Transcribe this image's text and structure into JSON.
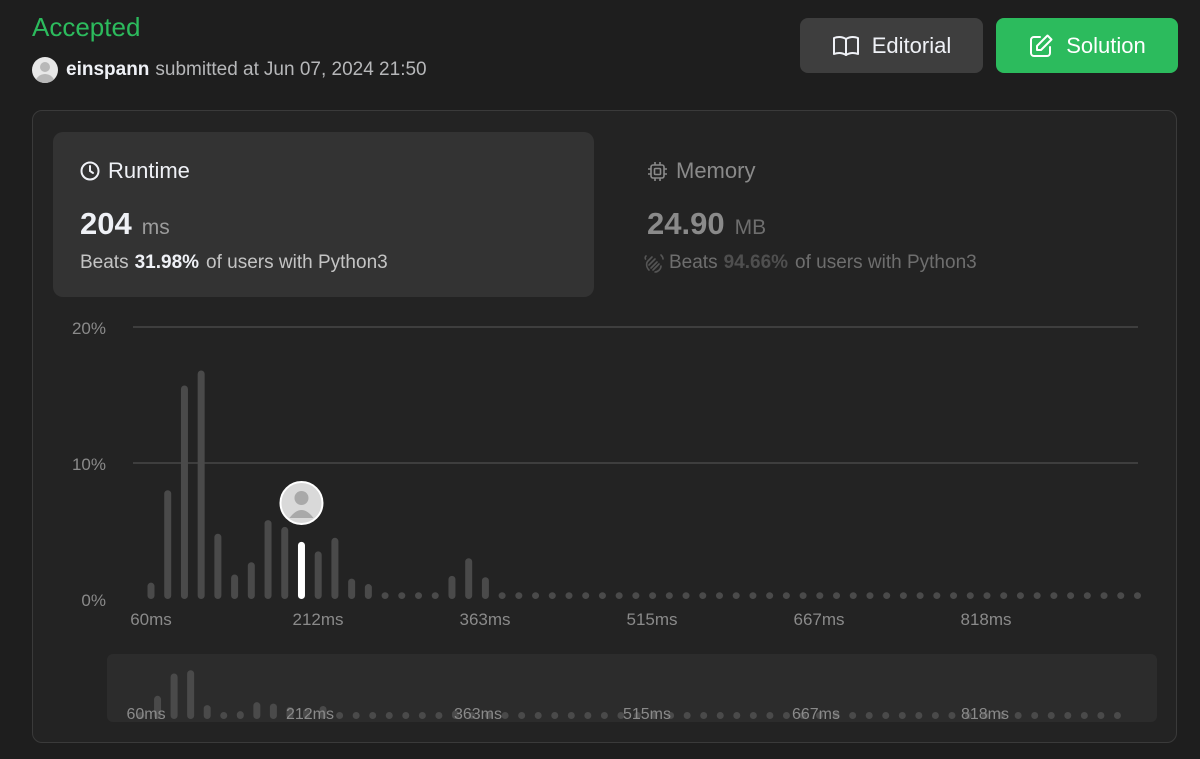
{
  "status": {
    "label": "Accepted",
    "color": "#2cbb5d"
  },
  "submission": {
    "username": "einspann",
    "submitted_text": "submitted at",
    "timestamp": "Jun 07, 2024 21:50"
  },
  "buttons": {
    "editorial": {
      "label": "Editorial",
      "icon": "book-icon"
    },
    "solution": {
      "label": "Solution",
      "icon": "edit-icon",
      "color": "#2cbb5d"
    }
  },
  "runtime": {
    "title": "Runtime",
    "icon": "clock-icon",
    "value": "204",
    "unit": "ms",
    "beats_prefix": "Beats",
    "beats_pct": "31.98%",
    "beats_suffix": "of users with Python3"
  },
  "memory": {
    "title": "Memory",
    "icon": "chip-icon",
    "value": "24.90",
    "unit": "MB",
    "beats_prefix": "Beats",
    "beats_pct": "94.66%",
    "beats_suffix": "of users with Python3"
  },
  "chart_data": {
    "type": "bar",
    "title": "",
    "xlabel": "",
    "ylabel": "",
    "ylim": [
      0,
      20
    ],
    "y_ticks": [
      "20%",
      "10%",
      "0%"
    ],
    "x_ticks": [
      "60ms",
      "212ms",
      "363ms",
      "515ms",
      "667ms",
      "818ms"
    ],
    "values": [
      1.2,
      8.0,
      15.7,
      16.8,
      4.8,
      1.8,
      2.7,
      5.8,
      5.3,
      4.2,
      3.5,
      4.5,
      1.5,
      1.1,
      0.5,
      0.5,
      0.5,
      0.5,
      1.7,
      3.0,
      1.6,
      0.5,
      0.5,
      0.5,
      0.5,
      0.5,
      0.5,
      0.5,
      0.5,
      0.5,
      0.5,
      0.5,
      0.5,
      0.5,
      0.5,
      0.5,
      0.5,
      0.5,
      0.5,
      0.5,
      0.5,
      0.5,
      0.5,
      0.5,
      0.5,
      0.5,
      0.5,
      0.5,
      0.5,
      0.5,
      0.5,
      0.5,
      0.5,
      0.5,
      0.5,
      0.5,
      0.5,
      0.5,
      0.5,
      0.5
    ],
    "highlight_index": 9,
    "grid": true
  }
}
